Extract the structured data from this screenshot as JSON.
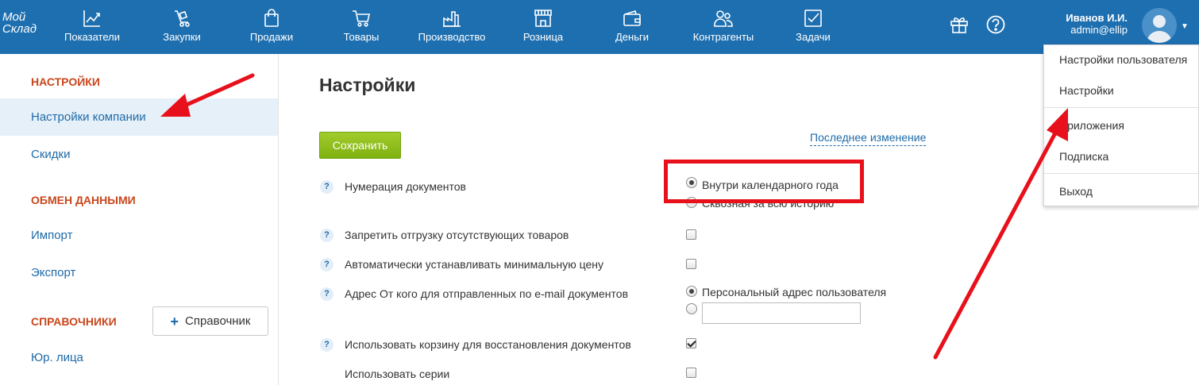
{
  "logo": {
    "line1": "Мой",
    "line2": "Склад"
  },
  "nav": [
    {
      "label": "Показатели",
      "icon": "chart-line-icon"
    },
    {
      "label": "Закупки",
      "icon": "hand-truck-icon"
    },
    {
      "label": "Продажи",
      "icon": "shopping-bag-icon"
    },
    {
      "label": "Товары",
      "icon": "cart-icon"
    },
    {
      "label": "Производство",
      "icon": "factory-icon"
    },
    {
      "label": "Розница",
      "icon": "shop-icon"
    },
    {
      "label": "Деньги",
      "icon": "wallet-icon"
    },
    {
      "label": "Контрагенты",
      "icon": "people-icon"
    },
    {
      "label": "Задачи",
      "icon": "task-check-icon"
    }
  ],
  "header_icons": {
    "gift": "gift-icon",
    "help": "help-circle-icon"
  },
  "user": {
    "name": "Иванов И.И.",
    "login": "admin@ellip"
  },
  "user_menu": [
    {
      "label": "Настройки пользователя"
    },
    {
      "label": "Настройки"
    },
    {
      "label": "Приложения"
    },
    {
      "label": "Подписка"
    },
    {
      "label": "Выход"
    }
  ],
  "sidebar": {
    "sections": [
      {
        "title": "НАСТРОЙКИ",
        "items": [
          "Настройки компании",
          "Скидки"
        ]
      },
      {
        "title": "ОБМЕН ДАННЫМИ",
        "items": [
          "Импорт",
          "Экспорт"
        ]
      },
      {
        "title": "СПРАВОЧНИКИ",
        "items": [
          "Юр. лица"
        ]
      }
    ],
    "add_reference_button": "Справочник",
    "active_item": "Настройки компании"
  },
  "main": {
    "title": "Настройки",
    "save_button": "Сохранить",
    "last_change_link": "Последнее изменение",
    "help_symbol": "?",
    "settings": [
      {
        "label": "Нумерация документов",
        "options": [
          "Внутри календарного года",
          "Сквозная за всю историю"
        ],
        "selected": 0
      },
      {
        "label": "Запретить отгрузку отсутствующих товаров",
        "checked": false
      },
      {
        "label": "Автоматически устанавливать минимальную цену",
        "checked": false
      },
      {
        "label": "Адрес От кого для отправленных по e-mail документов",
        "options": [
          "Персональный адрес пользователя"
        ],
        "selected": 0,
        "email_value": ""
      },
      {
        "label": "Использовать корзину для восстановления документов",
        "checked": true
      },
      {
        "label": "Использовать серии",
        "checked": false
      }
    ]
  },
  "colors": {
    "header_bg": "#1e6fb0",
    "section_title": "#c9461c",
    "link": "#1e6aa8",
    "save_button": "#8fbf1f",
    "annotation": "#e8101a",
    "active_bg": "#e6f0f9"
  }
}
